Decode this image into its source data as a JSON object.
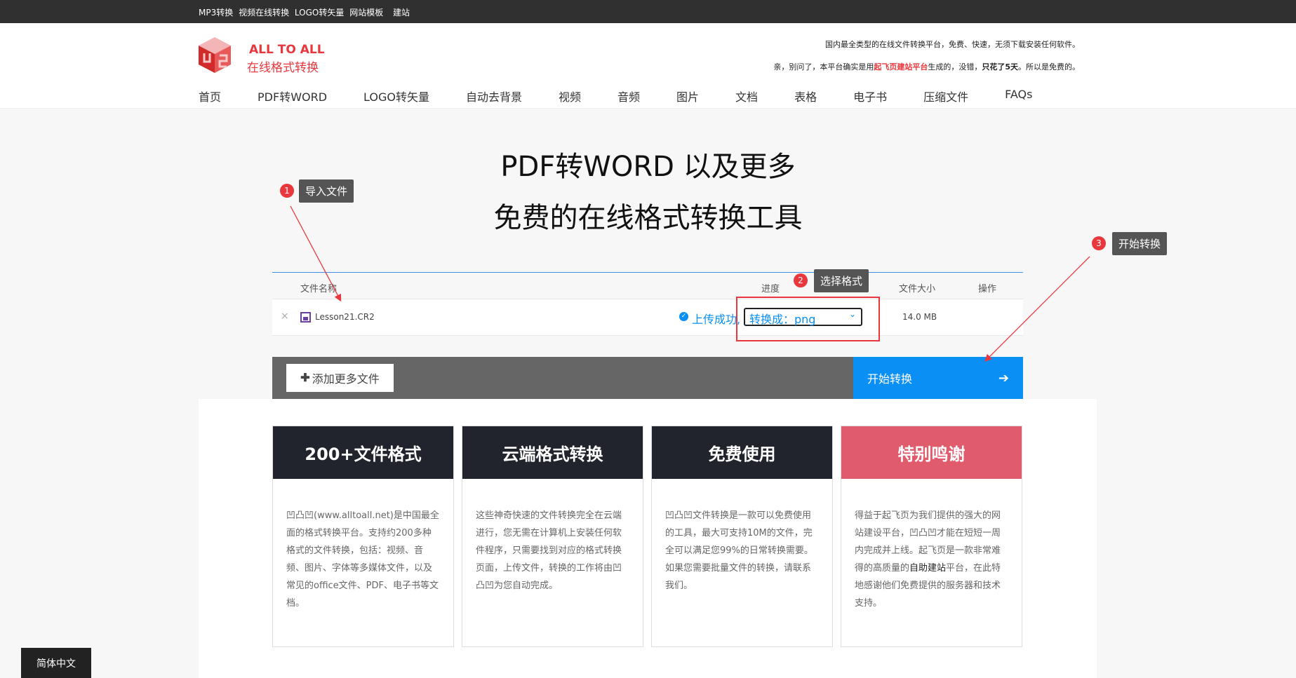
{
  "topbar": {
    "links": [
      "MP3转换",
      "视频在线转换",
      "LOGO转矢量",
      "网站模板",
      "建站"
    ]
  },
  "header": {
    "logo_line1": "ALL TO ALL",
    "logo_line2": "在线格式转换",
    "slogan1": "国内最全类型的在线文件转换平台，免费、快速，无须下载安装任何软件。",
    "slogan2_a": "亲，别问了，本平台确实是用",
    "slogan2_red": "起飞页建站平台",
    "slogan2_b": "生成的，没错，",
    "slogan2_bold": "只花了5天",
    "slogan2_c": "。所以是免费的。"
  },
  "nav": [
    "首页",
    "PDF转WORD",
    "LOGO转矢量",
    "自动去背景",
    "视频",
    "音频",
    "图片",
    "文档",
    "表格",
    "电子书",
    "压缩文件",
    "FAQs"
  ],
  "hero": {
    "title": "PDF转WORD 以及更多",
    "subtitle": "免费的在线格式转换工具"
  },
  "table": {
    "headers": {
      "name": "文件名称",
      "progress": "进度",
      "size": "文件大小",
      "action": "操作"
    },
    "row": {
      "remove": "×",
      "filename": "Lesson21.CR2",
      "status": "上传成功,",
      "convert": "转换成：png",
      "size": "14.0 MB"
    }
  },
  "actions": {
    "add": "添加更多文件",
    "start": "开始转换"
  },
  "cards": [
    {
      "title": "200+文件格式",
      "body": "凹凸凹(www.alltoall.net)是中国最全面的格式转换平台。支持约200多种格式的文件转换，包括：视频、音频、图片、字体等多媒体文件，以及常见的office文件、PDF、电子书等文档。"
    },
    {
      "title": "云端格式转换",
      "body": "这些神奇快速的文件转换完全在云端进行，您无需在计算机上安装任何软件程序，只需要找到对应的格式转换页面，上传文件，转换的工作将由凹凸凹为您自动完成。"
    },
    {
      "title": "免费使用",
      "body": "凹凸凹文件转换是一款可以免费使用的工具，最大可支持10M的文件，完全可以满足您99%的日常转换需要。如果您需要批量文件的转换，请联系我们。"
    },
    {
      "title": "特别鸣谢",
      "body_a": "得益于起飞页为我们提供的强大的网站建设平台，凹凸凹才能在短短一周内完成并上线。起飞页是一款非常难得的高质量的",
      "body_link": "自助建站",
      "body_b": "平台，在此特地感谢他们免费提供的服务器和技术支持。"
    }
  ],
  "annotations": [
    {
      "n": "1",
      "label": "导入文件"
    },
    {
      "n": "2",
      "label": "选择格式"
    },
    {
      "n": "3",
      "label": "开始转换"
    }
  ],
  "language": "简体中文",
  "colors": {
    "accent": "#0a8ff5",
    "red": "#e8383d",
    "card_dark": "#21242d",
    "card_pink": "#e05c6c"
  }
}
